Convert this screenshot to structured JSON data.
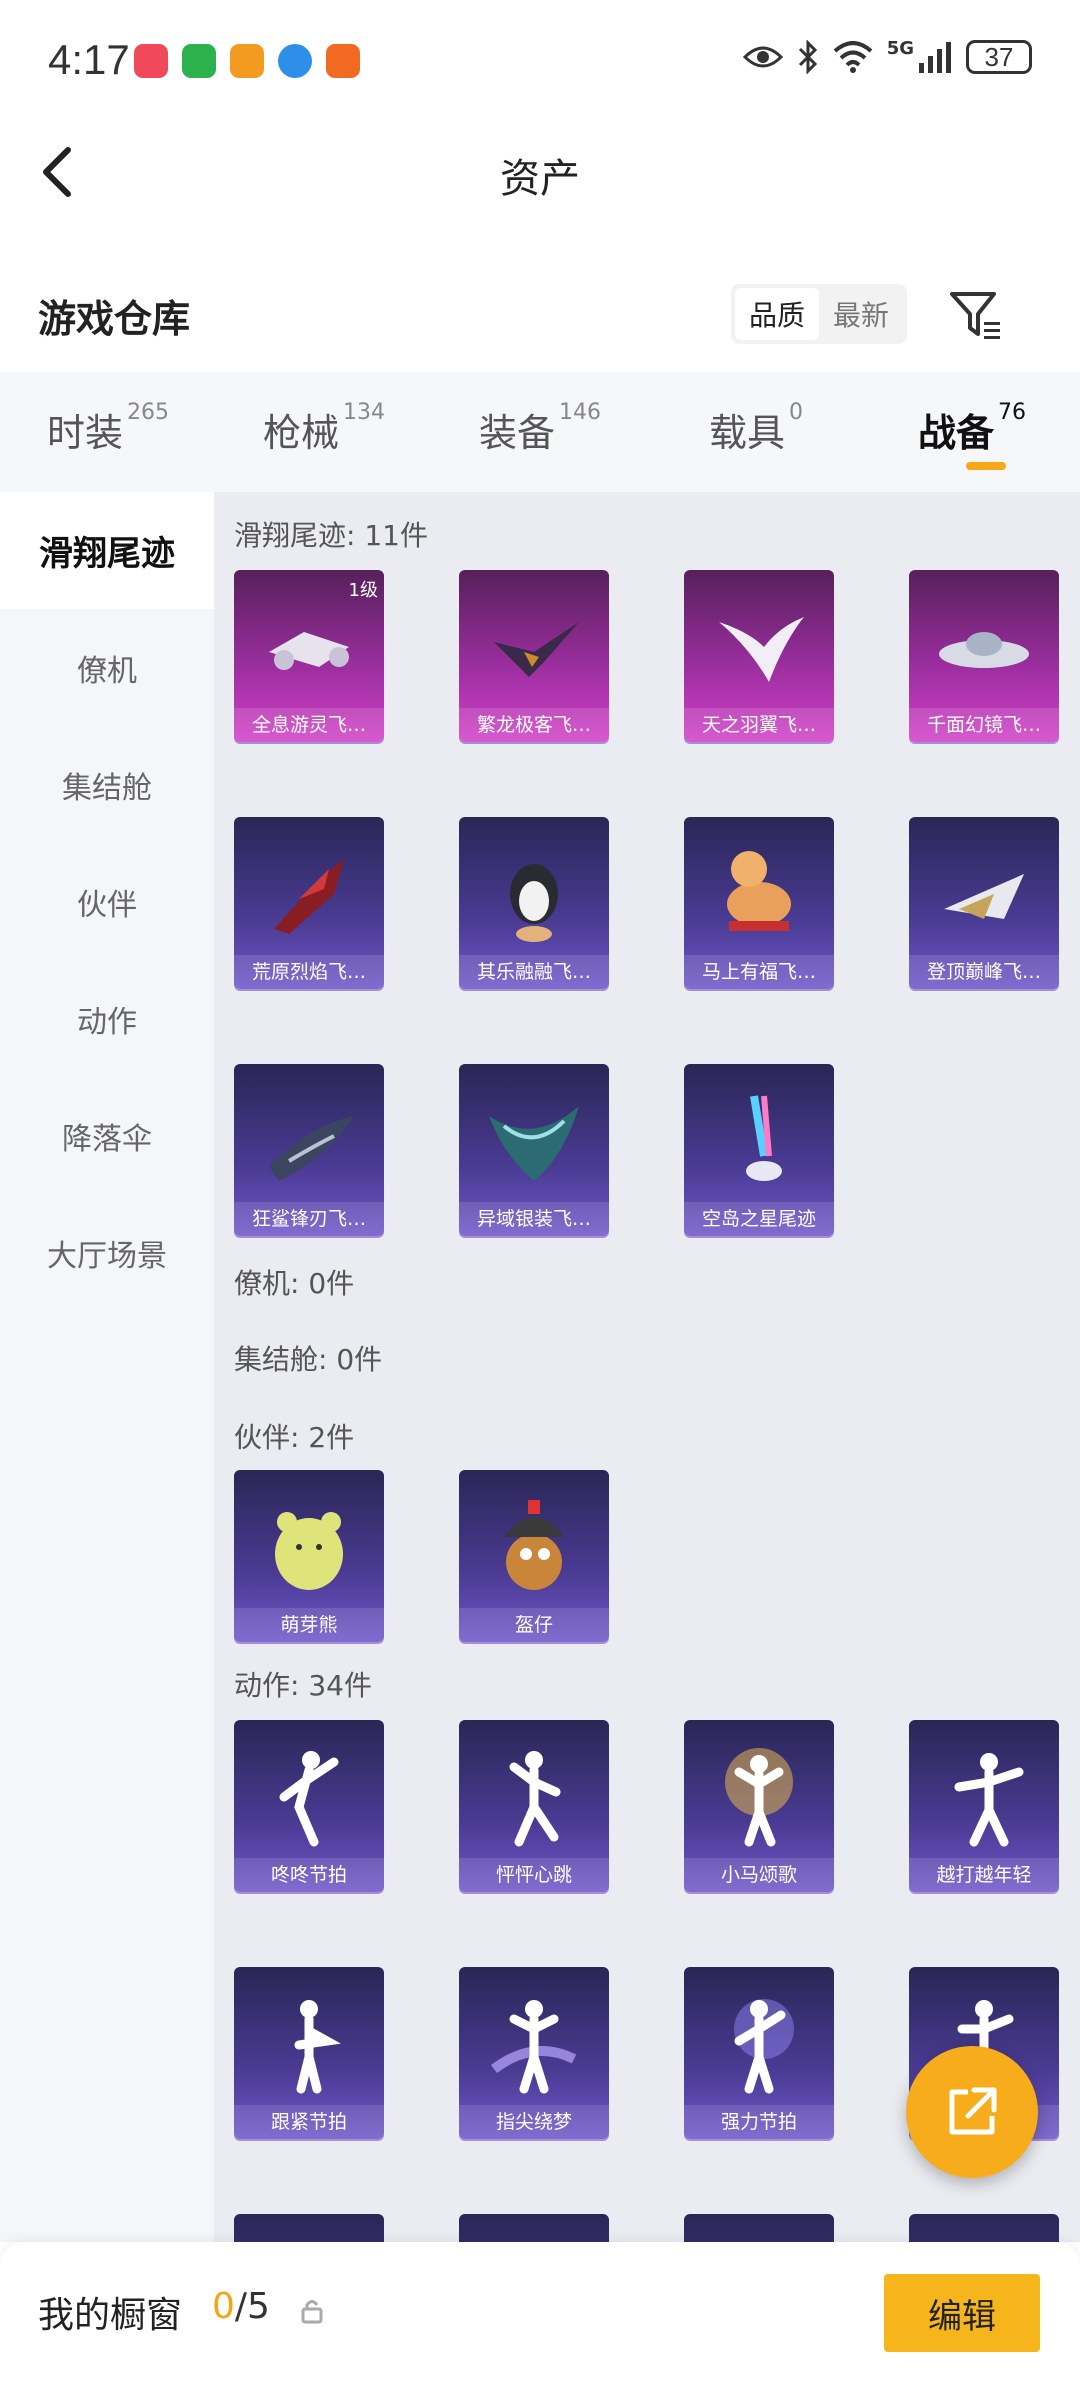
{
  "status": {
    "time": "4:17",
    "battery": "37",
    "network": "5G"
  },
  "header": {
    "title": "资产"
  },
  "warehouse": {
    "title": "游戏仓库",
    "sort_options": [
      "品质",
      "最新"
    ],
    "active_sort": "品质"
  },
  "tabs": [
    {
      "label": "时装",
      "count": "265"
    },
    {
      "label": "枪械",
      "count": "134"
    },
    {
      "label": "装备",
      "count": "146"
    },
    {
      "label": "载具",
      "count": "0"
    },
    {
      "label": "战备",
      "count": "76"
    }
  ],
  "active_tab": "战备",
  "sidebar": {
    "items": [
      "滑翔尾迹",
      "僚机",
      "集结舱",
      "伙伴",
      "动作",
      "降落伞",
      "大厅场景"
    ],
    "active": "滑翔尾迹"
  },
  "groups": {
    "glide": {
      "title": "滑翔尾迹: 11件",
      "items": [
        {
          "name": "全息游灵飞…",
          "rarity": "pink",
          "level": "1级"
        },
        {
          "name": "繁龙极客飞…",
          "rarity": "pink"
        },
        {
          "name": "天之羽翼飞…",
          "rarity": "pink"
        },
        {
          "name": "千面幻镜飞…",
          "rarity": "pink"
        },
        {
          "name": "荒原烈焰飞…",
          "rarity": "purple"
        },
        {
          "name": "其乐融融飞…",
          "rarity": "purple"
        },
        {
          "name": "马上有福飞…",
          "rarity": "purple"
        },
        {
          "name": "登顶巅峰飞…",
          "rarity": "purple"
        },
        {
          "name": "狂鲨锋刃飞…",
          "rarity": "purple"
        },
        {
          "name": "异域银装飞…",
          "rarity": "purple"
        },
        {
          "name": "空岛之星尾迹",
          "rarity": "purple"
        }
      ]
    },
    "wingman": {
      "title": "僚机: 0件"
    },
    "pod": {
      "title": "集结舱: 0件"
    },
    "partner": {
      "title": "伙伴: 2件",
      "items": [
        {
          "name": "萌芽熊",
          "rarity": "purple"
        },
        {
          "name": "盔仔",
          "rarity": "purple"
        }
      ]
    },
    "emote": {
      "title": "动作: 34件",
      "items": [
        {
          "name": "咚咚节拍",
          "rarity": "purple"
        },
        {
          "name": "怦怦心跳",
          "rarity": "purple"
        },
        {
          "name": "小马颂歌",
          "rarity": "purple"
        },
        {
          "name": "越打越年轻",
          "rarity": "purple"
        },
        {
          "name": "跟紧节拍",
          "rarity": "purple"
        },
        {
          "name": "指尖绕梦",
          "rarity": "purple"
        },
        {
          "name": "强力节拍",
          "rarity": "purple"
        },
        {
          "name": "",
          "rarity": "purple"
        }
      ]
    }
  },
  "bottom": {
    "label": "我的橱窗",
    "current": "0",
    "separator_total": "/5",
    "edit_label": "编辑"
  },
  "colors": {
    "accent": "#f7ac1b",
    "pink_item": "#d241c8",
    "purple_item": "#4a3b93"
  }
}
